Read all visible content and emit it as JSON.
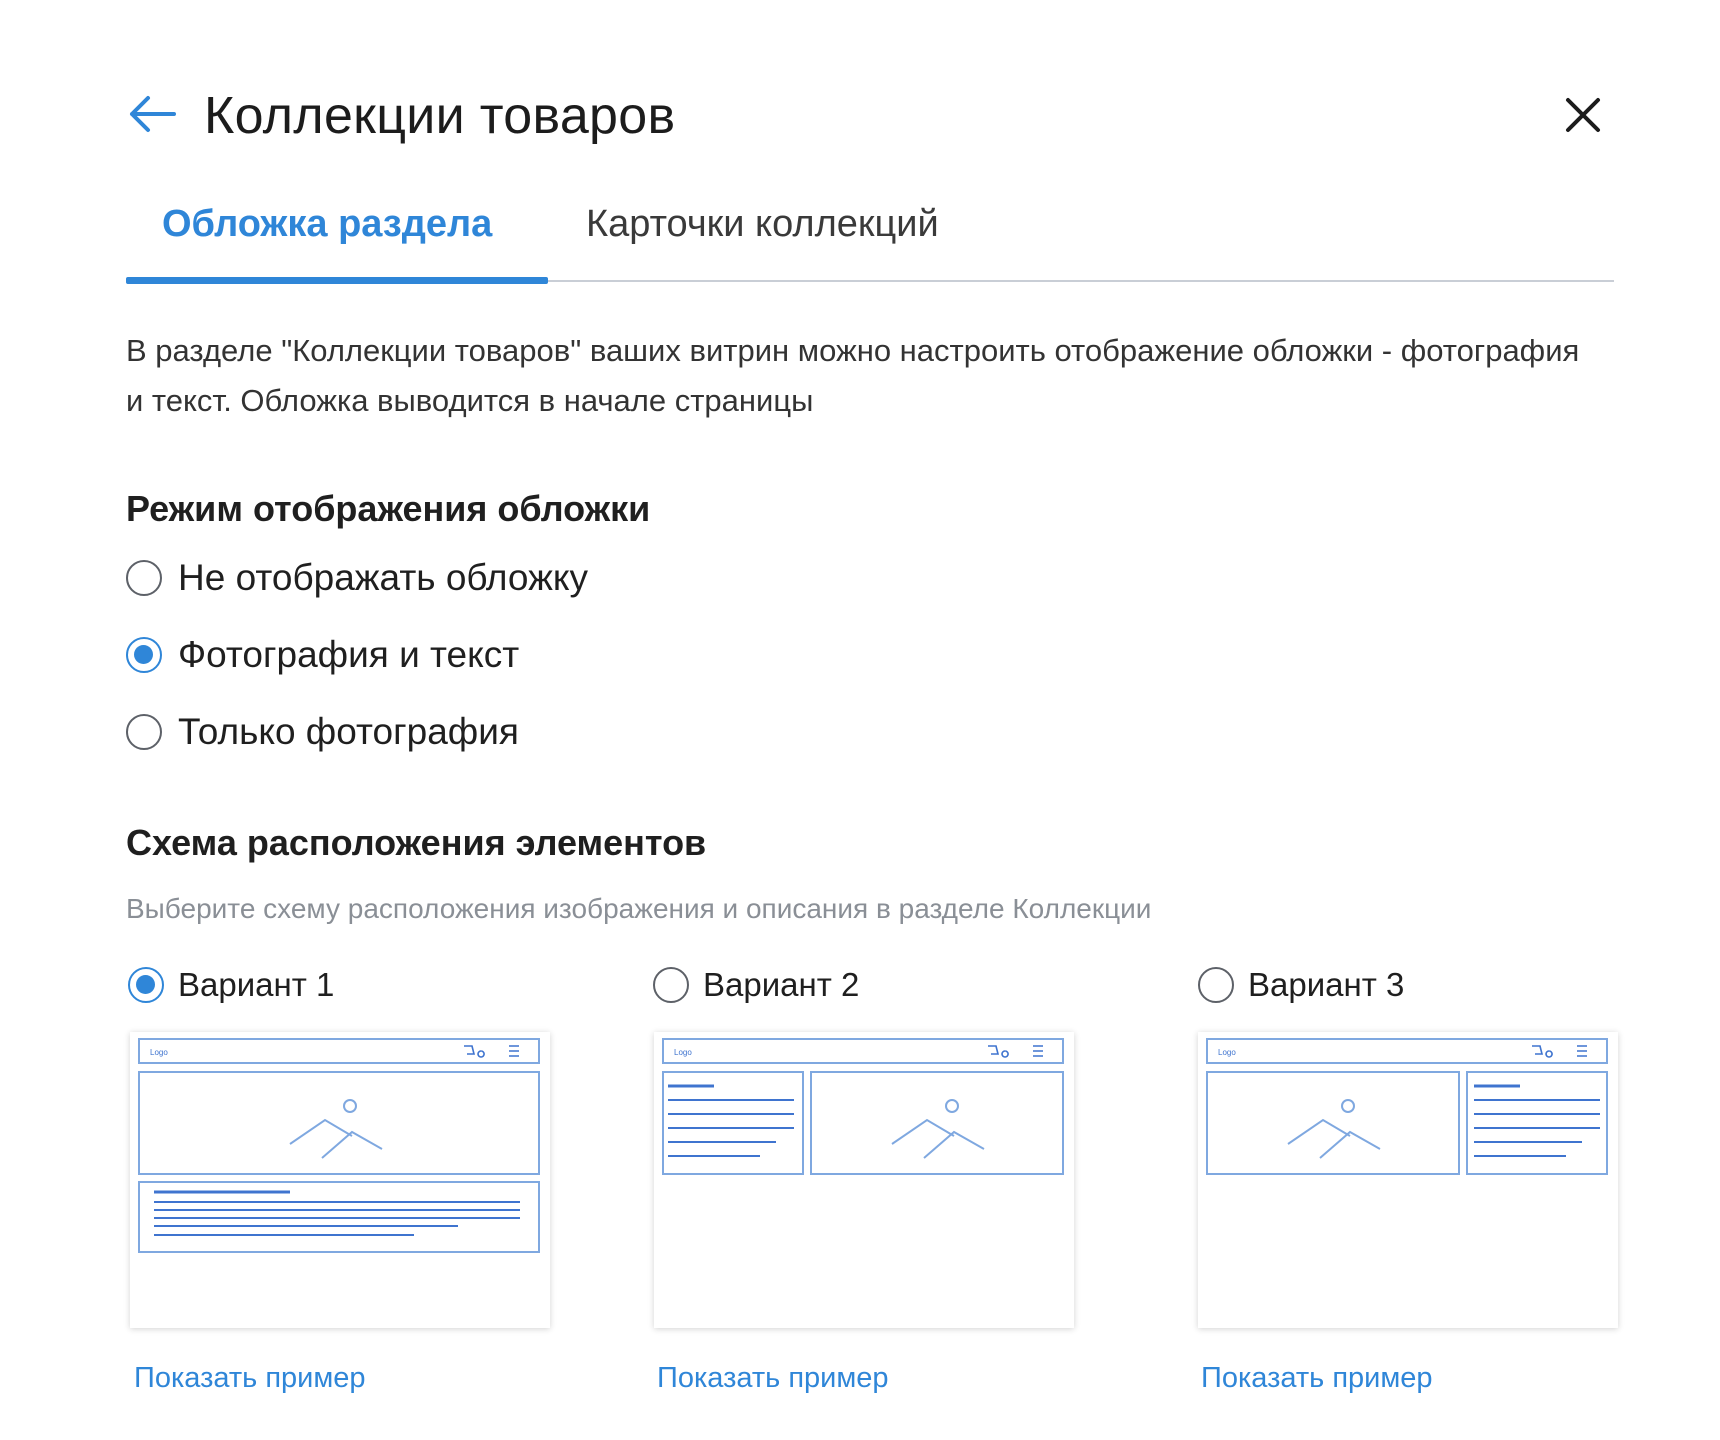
{
  "header": {
    "title": "Коллекции товаров",
    "back_icon": "arrow-left-icon",
    "close_icon": "close-icon"
  },
  "tabs": [
    {
      "label": "Обложка раздела",
      "active": true
    },
    {
      "label": "Карточки коллекций",
      "active": false
    }
  ],
  "intro": "В разделе \"Коллекции товаров\" ваших витрин можно настроить отображение обложки - фотография и текст. Обложка выводится в начале страницы",
  "cover_mode": {
    "title": "Режим отображения обложки",
    "options": [
      {
        "label": "Не отображать обложку",
        "checked": false
      },
      {
        "label": "Фотография и текст",
        "checked": true
      },
      {
        "label": "Только фотография",
        "checked": false
      }
    ]
  },
  "layout_scheme": {
    "title": "Схема расположения элементов",
    "hint": "Выберите схему расположения изображения и описания в разделе Коллекции",
    "variants": [
      {
        "label": "Вариант 1",
        "checked": true,
        "link": "Показать пример",
        "preview_logo": "Logo"
      },
      {
        "label": "Вариант 2",
        "checked": false,
        "link": "Показать пример",
        "preview_logo": "Logo"
      },
      {
        "label": "Вариант 3",
        "checked": false,
        "link": "Показать пример",
        "preview_logo": "Logo"
      }
    ]
  },
  "colors": {
    "accent": "#2f86d8",
    "wireframe": "#7fa8e0",
    "wireframe_text": "#3f74cf"
  }
}
